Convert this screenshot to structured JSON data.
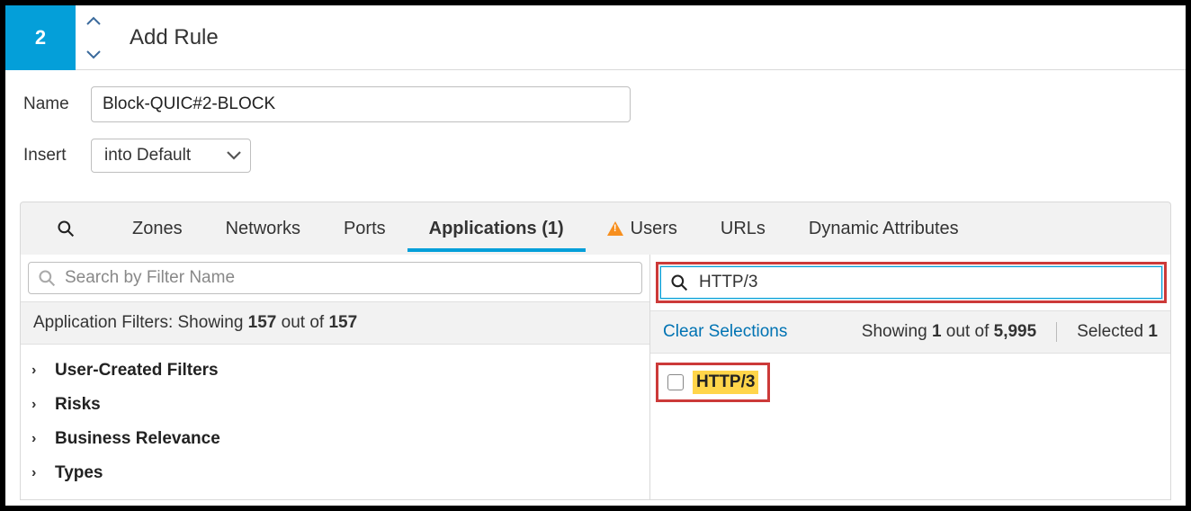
{
  "header": {
    "rule_number": "2",
    "title": "Add Rule"
  },
  "form": {
    "name_label": "Name",
    "name_value": "Block-QUIC#2-BLOCK",
    "insert_label": "Insert",
    "insert_value": "into Default"
  },
  "tabs": {
    "zones": "Zones",
    "networks": "Networks",
    "ports": "Ports",
    "applications": "Applications (1)",
    "users": "Users",
    "urls": "URLs",
    "dynamic": "Dynamic Attributes"
  },
  "left": {
    "search_placeholder": "Search by Filter Name",
    "status_prefix": "Application Filters: Showing ",
    "status_count": "157",
    "status_mid": " out of ",
    "status_total": "157",
    "filters": {
      "user_created": "User-Created Filters",
      "risks": "Risks",
      "business": "Business Relevance",
      "types": "Types"
    }
  },
  "right": {
    "search_value": "HTTP/3",
    "clear": "Clear Selections",
    "showing_prefix": "Showing ",
    "showing_count": "1",
    "showing_mid": " out of ",
    "showing_total": "5,995",
    "selected_label": "Selected ",
    "selected_count": "1",
    "result": "HTTP/3"
  }
}
